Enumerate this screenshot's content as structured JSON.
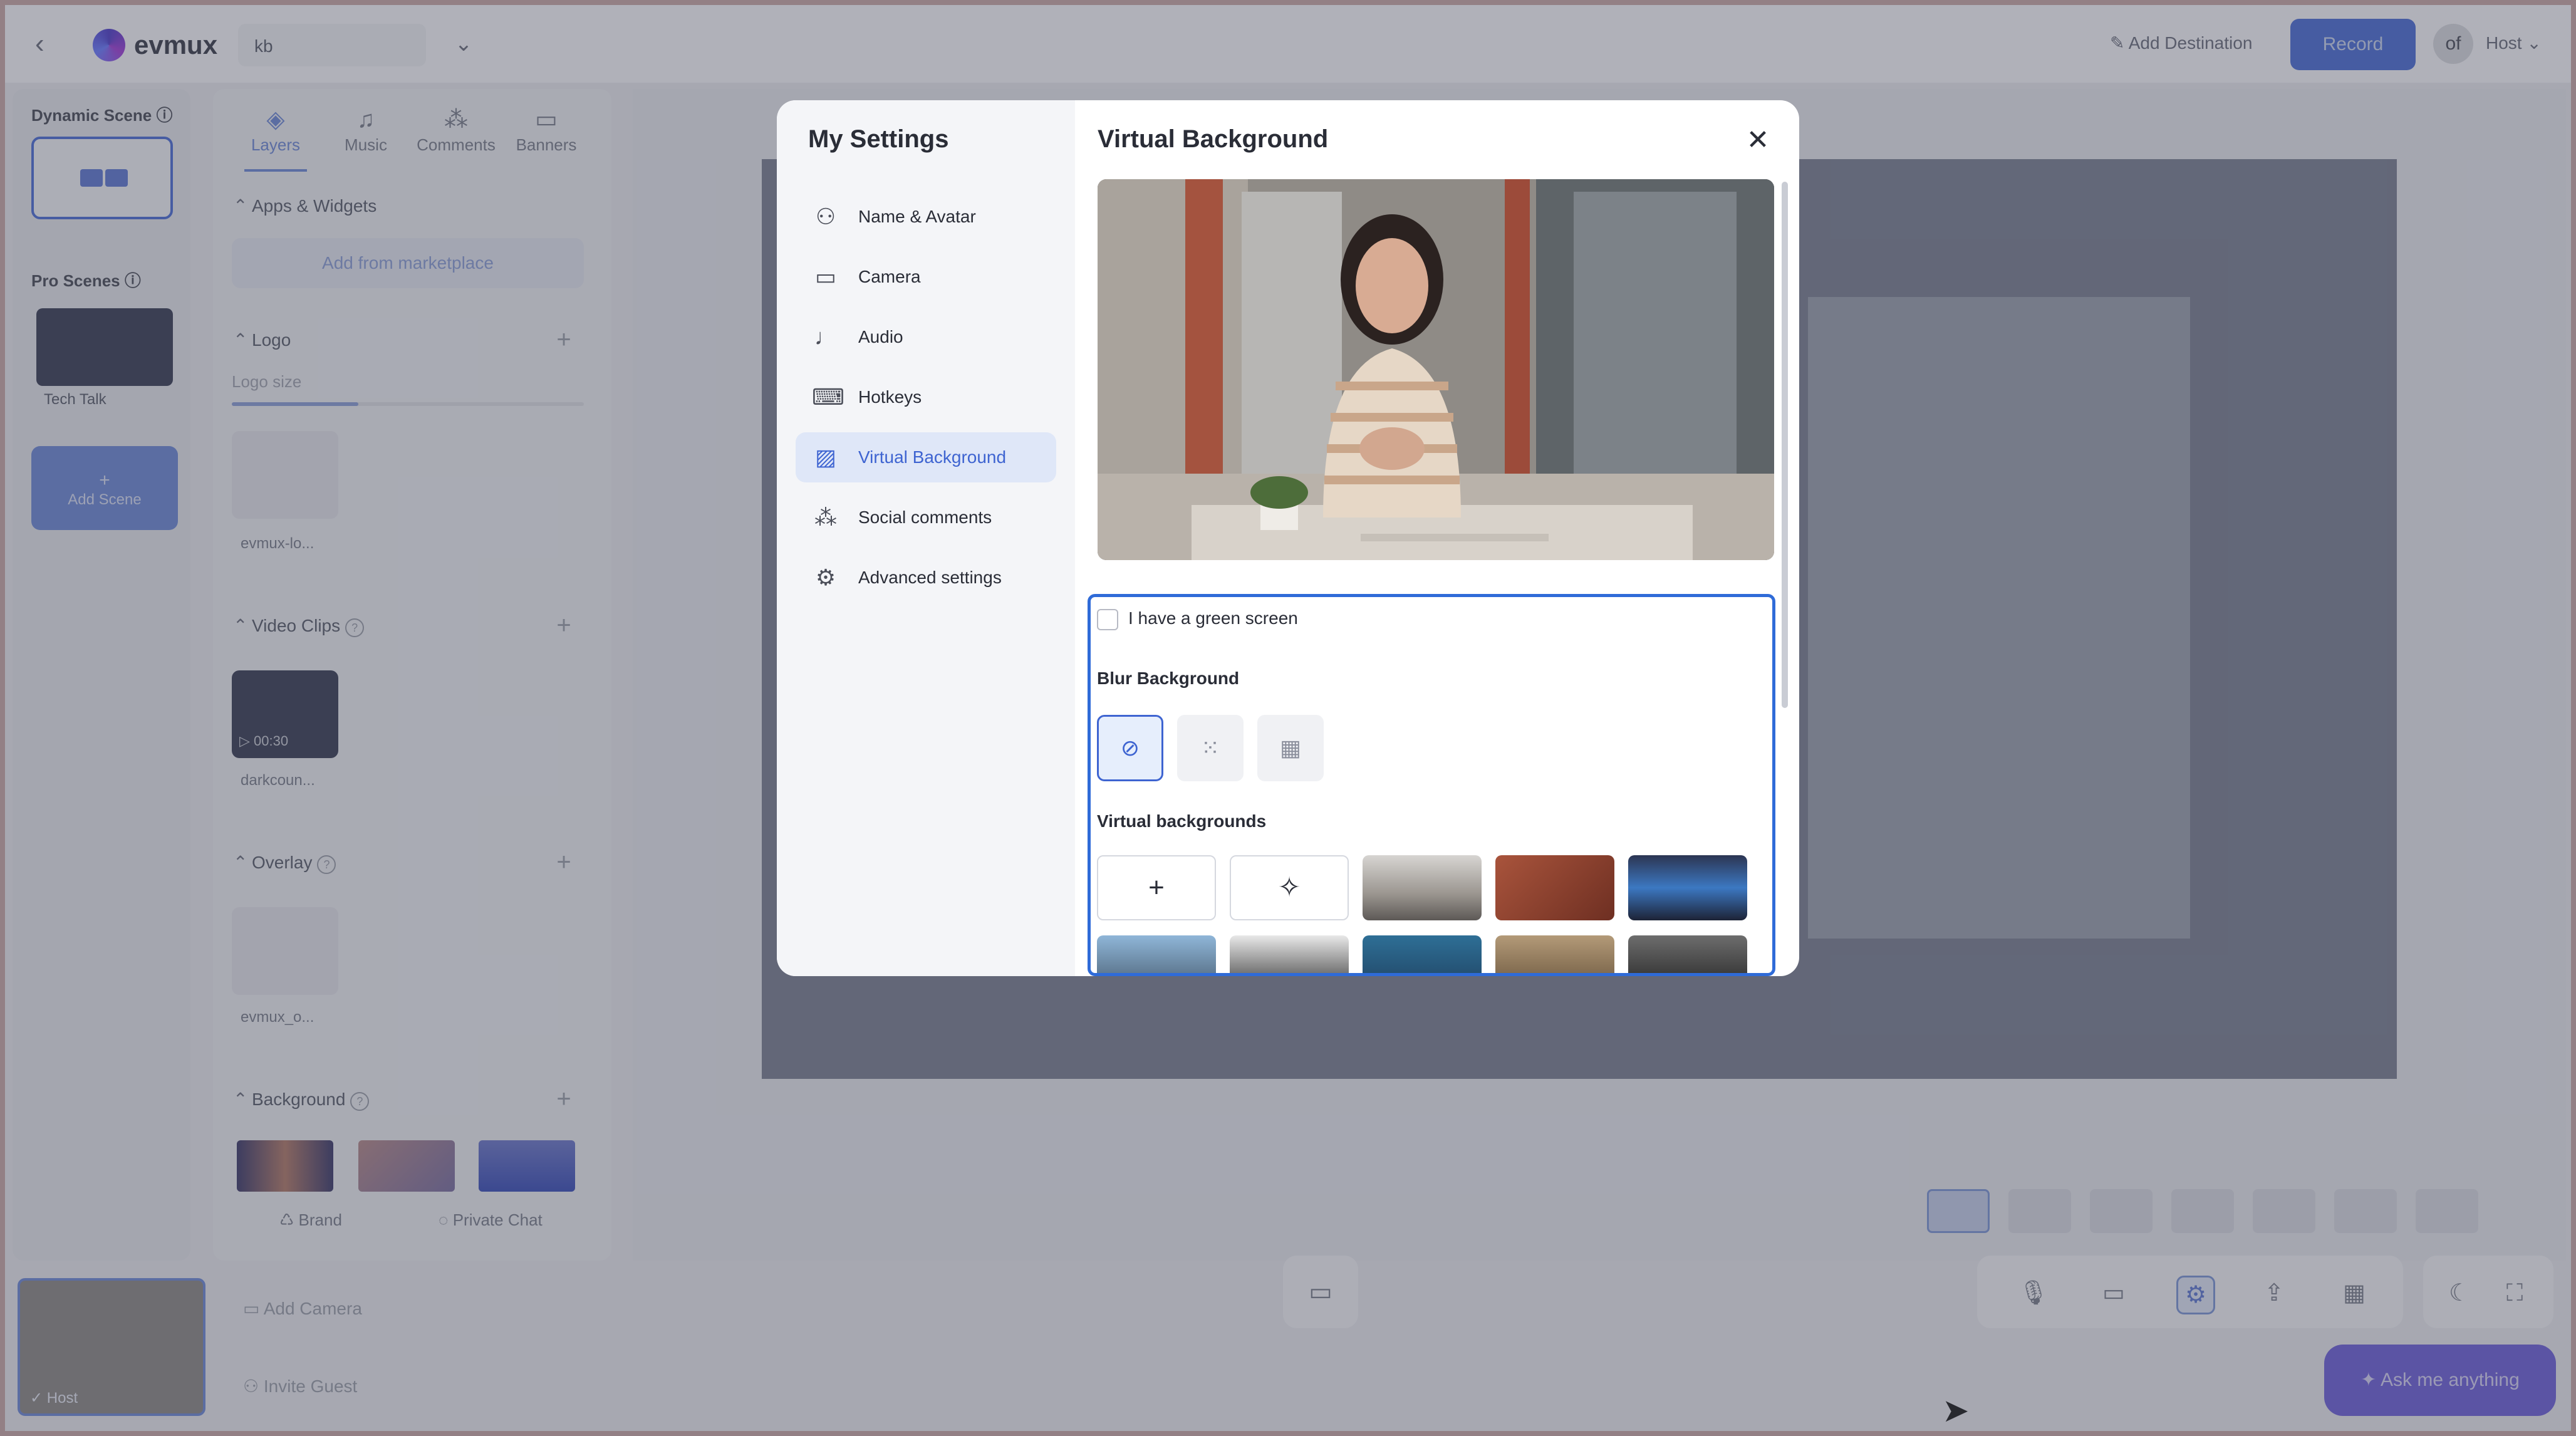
{
  "app": {
    "brand": "evmux",
    "studio_name": "kb",
    "add_destination": "Add Destination",
    "record_label": "Record",
    "user_initials": "of",
    "user_role": "Host"
  },
  "scenes": {
    "dynamic_label": "Dynamic Scene",
    "pro_label": "Pro Scenes",
    "pro_scene_name": "Tech Talk",
    "add_scene_label": "Add Scene"
  },
  "panel": {
    "tabs": [
      {
        "label": "Layers",
        "icon": "layers-icon"
      },
      {
        "label": "Music",
        "icon": "music-icon"
      },
      {
        "label": "Comments",
        "icon": "comments-icon"
      },
      {
        "label": "Banners",
        "icon": "banners-icon"
      }
    ],
    "apps_widgets": "Apps & Widgets",
    "add_marketplace": "Add from marketplace",
    "logo_section": "Logo",
    "logo_size": "Logo size",
    "logo_size_value": 0.36,
    "logo_asset": "evmux-lo...",
    "video_clips": "Video Clips",
    "clip_duration": "00:30",
    "clip_asset": "darkcoun...",
    "overlay": "Overlay",
    "overlay_asset": "evmux_o...",
    "background": "Background",
    "brand_label": "Brand",
    "private_chat": "Private Chat"
  },
  "bottom": {
    "host_label": "Host",
    "add_camera": "Add Camera",
    "invite_guest": "Invite Guest",
    "ask_anything": "Ask me anything"
  },
  "modal": {
    "title": "My Settings",
    "nav": [
      {
        "label": "Name & Avatar",
        "icon": "user-icon"
      },
      {
        "label": "Camera",
        "icon": "camera-icon"
      },
      {
        "label": "Audio",
        "icon": "microphone-icon"
      },
      {
        "label": "Hotkeys",
        "icon": "keyboard-icon"
      },
      {
        "label": "Virtual Background",
        "icon": "image-icon"
      },
      {
        "label": "Social comments",
        "icon": "social-icon"
      },
      {
        "label": "Advanced settings",
        "icon": "gear-icon"
      }
    ],
    "active_nav": "Virtual Background",
    "content_title": "Virtual Background",
    "green_screen": "I have a green screen",
    "blur_title": "Blur Background",
    "virtual_title": "Virtual backgrounds"
  },
  "colors": {
    "accent": "#3e64d1",
    "selection_border": "#2f6bd8",
    "record": "#4d6fd6",
    "ask": "#6f61d8"
  }
}
